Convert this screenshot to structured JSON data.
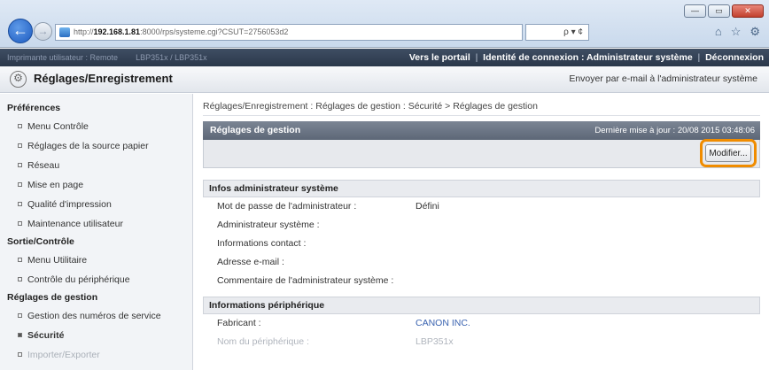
{
  "browser": {
    "url_prefix": "http://",
    "url_host": "192.168.1.81",
    "url_rest": ":8000/rps/systeme.cgi?CSUT=2756053d2",
    "search_label": "ρ ▾ ¢",
    "window_controls": [
      "—",
      "▭",
      "✕"
    ],
    "tool_icons": [
      "home-icon",
      "star-icon",
      "gear-icon"
    ],
    "tool_glyphs": [
      "⌂",
      "☆",
      "⚙"
    ]
  },
  "topbar": {
    "left_text": "Imprimante utilisateur : Remote",
    "left_text2": "LBP351x / LBP351x",
    "portal_link": "Vers le portail",
    "login_label": "Identité de connexion : Administrateur système",
    "logout_link": "Déconnexion"
  },
  "header": {
    "title": "Réglages/Enregistrement",
    "mail_link": "Envoyer par e-mail à l'administrateur système"
  },
  "sidebar": {
    "sections": [
      {
        "label": "Préférences",
        "items": [
          "Menu Contrôle",
          "Réglages de la source papier",
          "Réseau",
          "Mise en page",
          "Qualité d'impression",
          "Maintenance utilisateur"
        ]
      },
      {
        "label": "Sortie/Contrôle",
        "items": [
          "Menu Utilitaire",
          "Contrôle du périphérique"
        ]
      },
      {
        "label": "Réglages de gestion",
        "items": [
          "Gestion des numéros de service",
          "Sécurité",
          "Importer/Exporter"
        ]
      }
    ]
  },
  "main": {
    "breadcrumb": "Réglages/Enregistrement : Réglages de gestion : Sécurité > Réglages de gestion",
    "panel_title": "Réglages de gestion",
    "last_update": "Dernière mise à jour : 20/08 2015 03:48:06",
    "edit_button": "Modifier...",
    "admin_section": {
      "title": "Infos administrateur système",
      "rows": [
        {
          "label": "Mot de passe de l'administrateur :",
          "value": "Défini"
        },
        {
          "label": "Administrateur système :",
          "value": ""
        },
        {
          "label": "Informations contact :",
          "value": ""
        },
        {
          "label": "Adresse e-mail :",
          "value": ""
        },
        {
          "label": "Commentaire de l'administrateur système :",
          "value": ""
        }
      ]
    },
    "device_section": {
      "title": "Informations périphérique",
      "rows": [
        {
          "label": "Fabricant :",
          "value": "CANON INC."
        },
        {
          "label": "Nom du périphérique :",
          "value": "LBP351x"
        }
      ]
    }
  }
}
